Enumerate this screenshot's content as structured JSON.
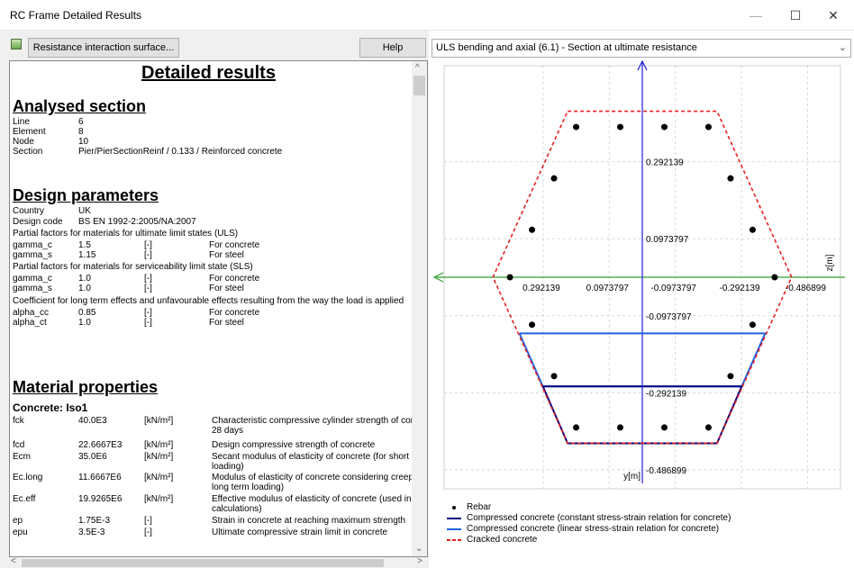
{
  "window": {
    "title": "RC Frame Detailed Results"
  },
  "toolbar": {
    "surface_button": "Resistance interaction surface...",
    "help_button": "Help"
  },
  "doc": {
    "title": "Detailed results",
    "analysed": {
      "heading": "Analysed section",
      "rows": [
        [
          "Line",
          "6"
        ],
        [
          "Element",
          "8"
        ],
        [
          "Node",
          "10"
        ],
        [
          "Section",
          "Pier/PierSectionReinf / 0.133 / Reinforced concrete"
        ]
      ]
    },
    "design": {
      "heading": "Design parameters",
      "rows": [
        [
          "Country",
          "UK"
        ],
        [
          "Design code",
          "BS EN 1992-2:2005/NA:2007"
        ]
      ],
      "uls_note": "Partial factors for materials for ultimate limit states (ULS)",
      "uls_rows": [
        [
          "gamma_c",
          "1.5",
          "[-]",
          "For concrete"
        ],
        [
          "gamma_s",
          "1.15",
          "[-]",
          "For steel"
        ]
      ],
      "sls_note": "Partial factors for materials for serviceability limit state (SLS)",
      "sls_rows": [
        [
          "gamma_c",
          "1.0",
          "[-]",
          "For concrete"
        ],
        [
          "gamma_s",
          "1.0",
          "[-]",
          "For steel"
        ]
      ],
      "coef_note": "Coefficient for long term effects and unfavourable effects resulting from the way the load is applied",
      "coef_rows": [
        [
          "alpha_cc",
          "0.85",
          "[-]",
          "For concrete"
        ],
        [
          "alpha_ct",
          "1.0",
          "[-]",
          "For steel"
        ]
      ]
    },
    "material": {
      "heading": "Material properties",
      "sub": "Concrete: Iso1",
      "rows": [
        [
          "fck",
          "40.0E3",
          "[kN/m²]",
          "Characteristic compressive cylinder strength of cor",
          "28 days"
        ],
        [
          "fcd",
          "22.6667E3",
          "[kN/m²]",
          "Design compressive strength of concrete",
          ""
        ],
        [
          "Ecm",
          "35.0E6",
          "[kN/m²]",
          "Secant modulus of elasticity of concrete (for short",
          "loading)"
        ],
        [
          "Ec.long",
          "11.6667E6",
          "[kN/m²]",
          "Modulus of elasticity of concrete considering creep",
          "long term loading)"
        ],
        [
          "Ec.eff",
          "19.9265E6",
          "[kN/m²]",
          "Effective modulus of elasticity of concrete (used in",
          "calculations)"
        ],
        [
          "ep",
          "1.75E-3",
          "[-]",
          "Strain in concrete at reaching maximum strength",
          ""
        ],
        [
          "epu",
          "3.5E-3",
          "[-]",
          "Ultimate compressive strain limit in concrete",
          ""
        ]
      ]
    }
  },
  "view_select": {
    "value": "ULS bending and axial (6.1) - Section at ultimate resistance"
  },
  "chart_data": {
    "type": "scatter",
    "x_label": "z[m]",
    "y_label": "y[m]",
    "x_ticks": [
      "0.292139",
      "0.0973797",
      "-0.0973797",
      "-0.292139",
      "-0.486899"
    ],
    "y_ticks": [
      "0.292139",
      "0.0973797",
      "-0.0973797",
      "-0.292139",
      "-0.486899"
    ],
    "x_tick_values": [
      0.292139,
      0.0973797,
      -0.0973797,
      -0.292139,
      -0.486899
    ],
    "y_tick_values": [
      0.292139,
      0.0973797,
      -0.0973797,
      -0.292139,
      -0.486899
    ],
    "x_range": [
      0.584,
      -0.584
    ],
    "y_range": [
      0.535,
      -0.535
    ],
    "grid": true,
    "rebar": [
      [
        0.195,
        0.38
      ],
      [
        0.065,
        0.38
      ],
      [
        -0.065,
        0.38
      ],
      [
        -0.195,
        0.38
      ],
      [
        0.26,
        0.25
      ],
      [
        -0.26,
        0.25
      ],
      [
        0.325,
        0.12
      ],
      [
        -0.325,
        0.12
      ],
      [
        0.39,
        0.0
      ],
      [
        -0.39,
        0.0
      ],
      [
        0.325,
        -0.12
      ],
      [
        -0.325,
        -0.12
      ],
      [
        0.26,
        -0.25
      ],
      [
        -0.26,
        -0.25
      ],
      [
        0.195,
        -0.38
      ],
      [
        0.065,
        -0.38
      ],
      [
        -0.065,
        -0.38
      ],
      [
        -0.195,
        -0.38
      ]
    ],
    "cracked": [
      [
        0.22,
        0.42
      ],
      [
        -0.22,
        0.42
      ],
      [
        -0.44,
        0.0
      ],
      [
        -0.22,
        -0.42
      ],
      [
        0.22,
        -0.42
      ],
      [
        0.44,
        0.0
      ],
      [
        0.22,
        0.42
      ]
    ],
    "compressed_const": [
      [
        0.293,
        -0.276
      ],
      [
        -0.293,
        -0.276
      ],
      [
        -0.22,
        -0.42
      ],
      [
        0.22,
        -0.42
      ],
      [
        0.293,
        -0.276
      ]
    ],
    "compressed_linear": [
      [
        0.362,
        -0.142
      ],
      [
        -0.362,
        -0.142
      ],
      [
        -0.293,
        -0.276
      ],
      [
        0.293,
        -0.276
      ],
      [
        0.362,
        -0.142
      ]
    ],
    "legend": [
      {
        "label": "Rebar",
        "color": "#000000",
        "kind": "dot"
      },
      {
        "label": "Compressed concrete (constant stress-strain relation for concrete)",
        "color": "#000080",
        "kind": "line"
      },
      {
        "label": "Compressed concrete (linear stress-strain relation for concrete)",
        "color": "#1e64e6",
        "kind": "line"
      },
      {
        "label": "Cracked concrete",
        "color": "#e82020",
        "kind": "dash"
      }
    ]
  }
}
